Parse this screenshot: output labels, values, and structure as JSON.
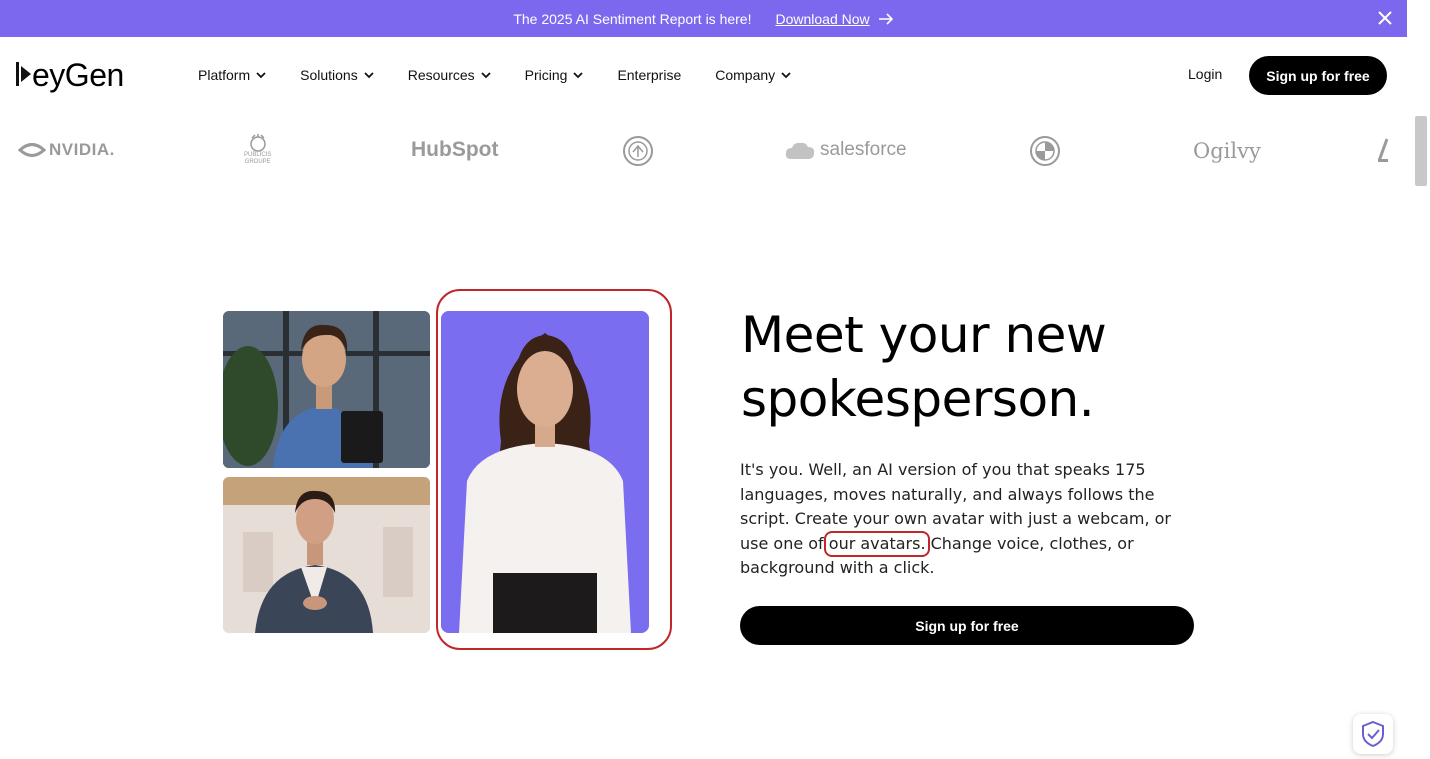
{
  "banner": {
    "message": "The 2025 AI Sentiment Report is here!",
    "link_label": "Download Now"
  },
  "header": {
    "logo_text": "eyGen",
    "nav": [
      {
        "label": "Platform"
      },
      {
        "label": "Solutions"
      },
      {
        "label": "Resources"
      },
      {
        "label": "Pricing"
      },
      {
        "label": "Enterprise"
      },
      {
        "label": "Company"
      }
    ],
    "login_label": "Login",
    "signup_label": "Sign up for free"
  },
  "logos": {
    "nvidia": "NVIDIA.",
    "publicis_line1": "PUBLICIS",
    "publicis_line2": "GROUPE",
    "hubspot": "HubSpot",
    "salesforce": "salesforce",
    "ogilvy": "Ogilvy"
  },
  "hero": {
    "headline": "Meet your new spokesperson.",
    "body_before": "It's you. Well, an AI version of you that speaks 175 languages, moves naturally, and always follows the script. Create your own avatar with just a webcam, or use one of ",
    "body_link": "our avatars.",
    "body_after": " Change voice, clothes, or background with a click.",
    "cta_label": "Sign up for free"
  },
  "colors": {
    "banner": "#7b68ee",
    "accent_purple": "#7a6df0",
    "highlight_red": "#c0272d"
  }
}
